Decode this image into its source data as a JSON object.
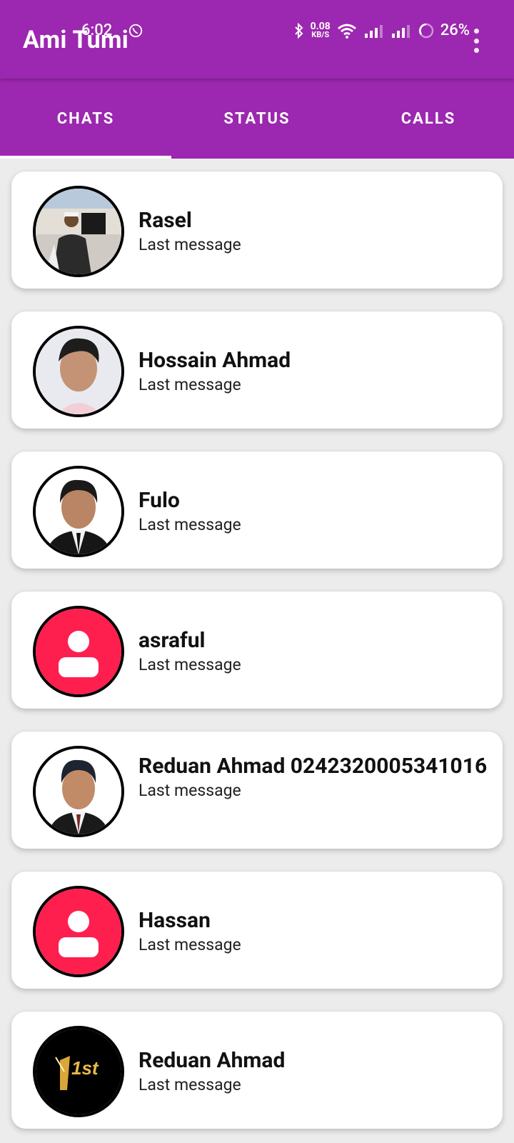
{
  "app": {
    "title": "Ami Tumi"
  },
  "status_bar": {
    "time": "6:02",
    "net_speed_value": "0.08",
    "net_speed_unit": "KB/S",
    "battery": "26%"
  },
  "tabs": [
    {
      "label": "CHATS"
    },
    {
      "label": "STATUS"
    },
    {
      "label": "CALLS"
    }
  ],
  "chats": [
    {
      "name": "Rasel",
      "message": "Last message",
      "avatar": "photo"
    },
    {
      "name": "Hossain Ahmad",
      "message": "Last message",
      "avatar": "photo"
    },
    {
      "name": "Fulo",
      "message": "Last message",
      "avatar": "photo"
    },
    {
      "name": "asraful",
      "message": "Last message",
      "avatar": "default"
    },
    {
      "name": "Reduan Ahmad 0242320005341016",
      "message": "Last message",
      "avatar": "photo"
    },
    {
      "name": "Hassan",
      "message": "Last message",
      "avatar": "default"
    },
    {
      "name": "Reduan Ahmad",
      "message": "Last message",
      "avatar": "logo",
      "avatar_text": "1st"
    }
  ],
  "colors": {
    "primary": "#9c27b0",
    "default_avatar": "#ff1f4f"
  }
}
